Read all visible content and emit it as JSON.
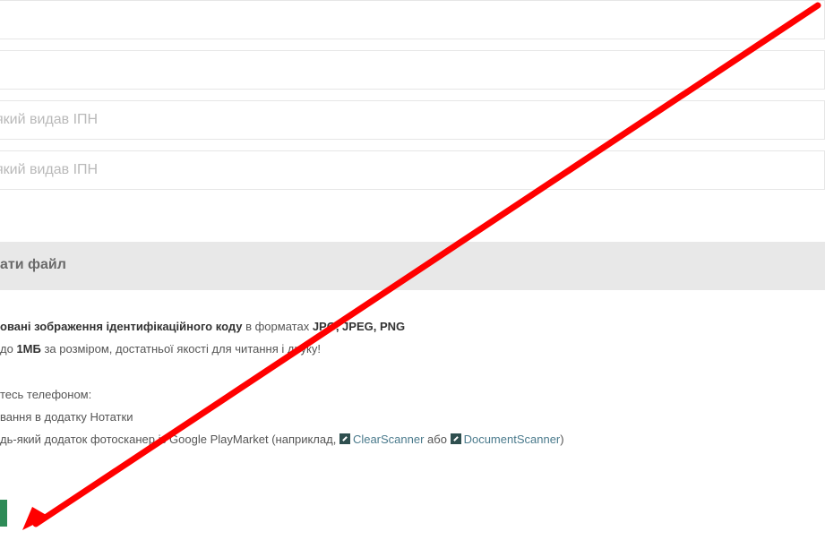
{
  "form": {
    "field1_placeholder": "",
    "field2_placeholder": "",
    "field3_placeholder": "який видав ІПН",
    "upload_label": "ати файл"
  },
  "info": {
    "line1_bold": "овані зображення ідентифікаційного коду",
    "line1_mid": " в форматах ",
    "line1_formats": "JPG, JPEG, PNG",
    "line2_pre": "до ",
    "line2_bold": "1МБ",
    "line2_post": " за розміром, достатньої якості для читання і друку!",
    "line3": "тесь телефоном:",
    "line4": "вання в додатку Нотатки",
    "line5_pre": "дь-який додаток фотосканер із Google PlayMarket (наприклад, ",
    "link1": "ClearScanner",
    "line5_mid": " або ",
    "link2": "DocumentScanner",
    "line5_post": ")"
  },
  "colors": {
    "annotation_arrow": "#ff0000",
    "upload_bar": "#e8e8e8",
    "accent": "#2e8b57"
  },
  "icons": [
    "external-link-icon",
    "annotation-arrow"
  ]
}
